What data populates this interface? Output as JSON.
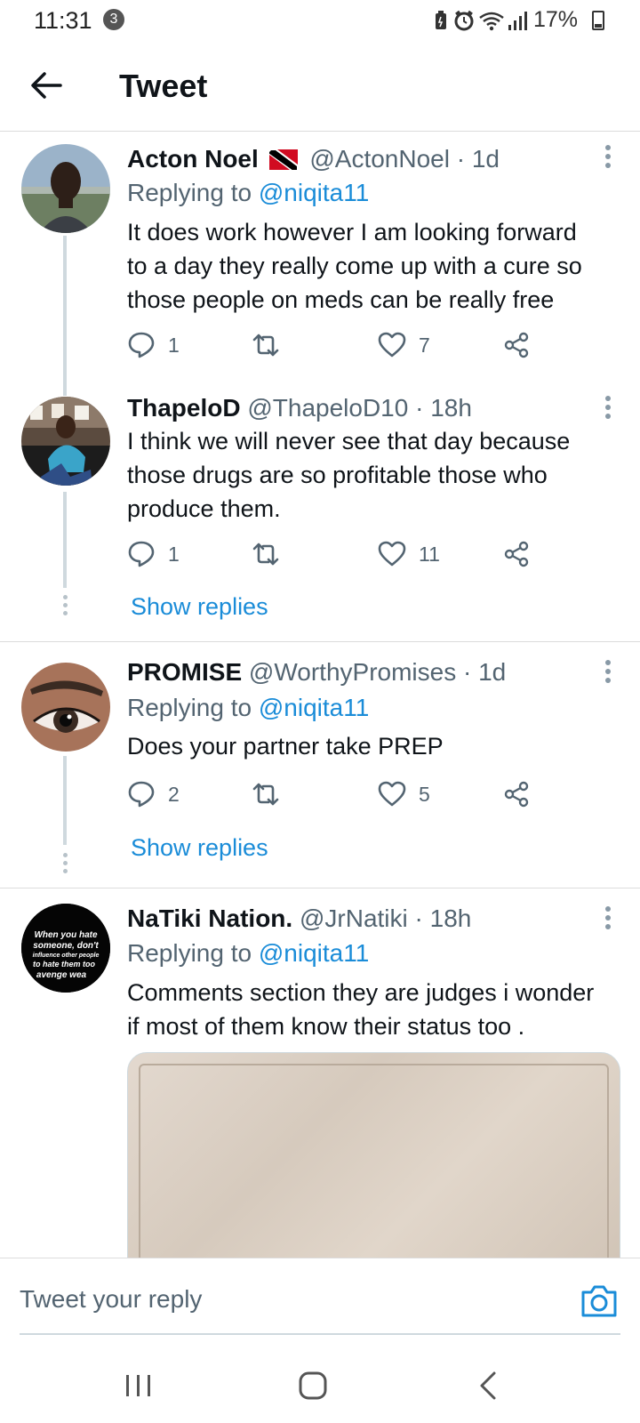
{
  "status_bar": {
    "time": "11:31",
    "notification_count": "3",
    "battery": "17%",
    "icons": [
      "battery-saver-icon",
      "alarm-icon",
      "wifi-icon",
      "signal-icon"
    ]
  },
  "header": {
    "title": "Tweet",
    "back_icon": "arrow-left-icon"
  },
  "tweets": [
    {
      "name": "Acton Noel",
      "has_flag": true,
      "handle": "@ActonNoel",
      "separator": "·",
      "time": "1d",
      "replying_label": "Replying to",
      "replying_to": "@niqita11",
      "lines": [
        "It does work however I am looking forward",
        "to a day they really come up with a cure so",
        "those people on meds can be really free"
      ],
      "replies": "1",
      "retweets": "",
      "likes": "7"
    },
    {
      "name": "ThapeloD",
      "handle": "@ThapeloD10",
      "separator": "·",
      "time": "18h",
      "lines": [
        "I think we will never see that day because",
        "those drugs are so profitable those who",
        "produce them."
      ],
      "replies": "1",
      "retweets": "",
      "likes": "11",
      "show_replies": "Show replies"
    },
    {
      "name": "PROMISE",
      "handle": "@WorthyPromises",
      "separator": "·",
      "time": "1d",
      "replying_label": "Replying to",
      "replying_to": "@niqita11",
      "lines": [
        "Does your partner take PREP"
      ],
      "replies": "2",
      "retweets": "",
      "likes": "5",
      "show_replies": "Show replies"
    },
    {
      "name": "NaTiki Nation.",
      "handle": "@JrNatiki",
      "separator": "·",
      "time": "18h",
      "replying_label": "Replying to",
      "replying_to": "@niqita11",
      "lines": [
        "Comments section they are judges i wonder",
        "if most of them know their status too ."
      ],
      "avatar_text": [
        "When you hate",
        "someone, don't",
        "influence other people",
        "to hate them too",
        "avenge wea"
      ]
    }
  ],
  "composer": {
    "placeholder": "Tweet your reply",
    "camera_icon": "camera-icon"
  },
  "nav": {
    "icons": [
      "recent-apps-icon",
      "home-icon",
      "back-icon"
    ]
  },
  "colors": {
    "link": "#1a8cd8",
    "text": "#0f1419",
    "secondary": "#536471",
    "divider": "#dcdcdc"
  }
}
